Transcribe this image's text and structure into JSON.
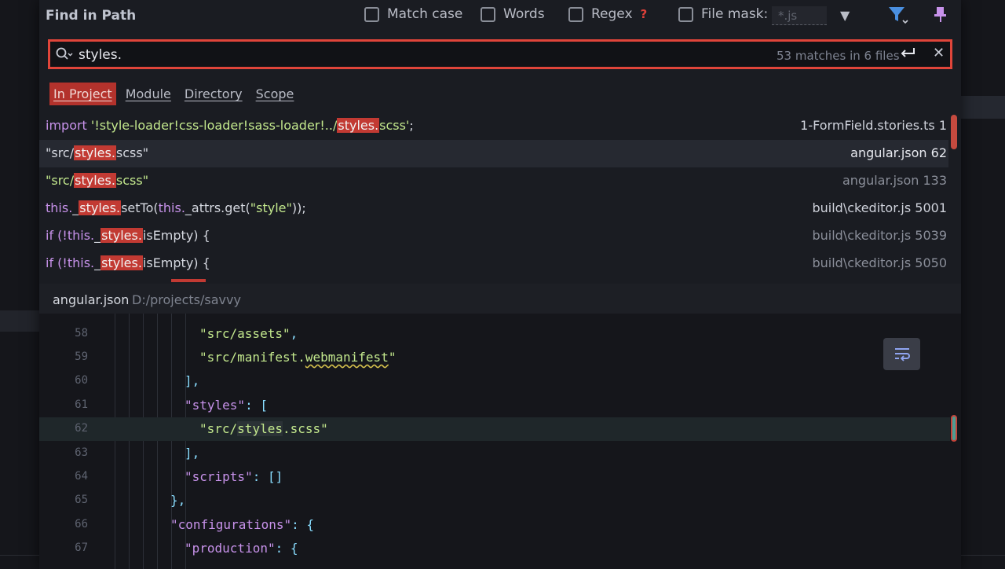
{
  "header": {
    "title": "Find in Path",
    "options": {
      "match_case": "Match case",
      "words": "Words",
      "regex": "Regex",
      "regex_help": "?",
      "file_mask": "File mask:"
    },
    "file_mask_value": "*.js"
  },
  "search": {
    "query": "styles.",
    "match_summary": "53 matches in 6 files"
  },
  "scopes": [
    "In Project",
    "Module",
    "Directory",
    "Scope"
  ],
  "results": [
    {
      "file": "1-FormField.stories.ts 1"
    },
    {
      "file": "angular.json 62"
    },
    {
      "file": "angular.json 133"
    },
    {
      "file": "build\\ckeditor.js 5001"
    },
    {
      "file": "build\\ckeditor.js 5039"
    },
    {
      "file": "build\\ckeditor.js 5050"
    }
  ],
  "result_code": {
    "r0": {
      "a": "import ",
      "b": "'!style-loader!css-loader!sass-loader!../",
      "hl": "styles.",
      "c": "scss'",
      "d": ";"
    },
    "r1": {
      "a": "\"src/",
      "hl": "styles.",
      "b": "scss\""
    },
    "r2": {
      "a": "\"src/",
      "hl": "styles.",
      "b": "scss\""
    },
    "r3": {
      "a": "this.",
      "b": "_",
      "hl": "styles.",
      "c": "setTo(",
      "d": "this.",
      "e": "_attrs.get(",
      "f": "\"style\"",
      "g": "));"
    },
    "r4": {
      "a": "if (!",
      "b": "this.",
      "c": "_",
      "hl": "styles.",
      "d": "isEmpty) {"
    },
    "r5": {
      "a": "if (!",
      "b": "this.",
      "c": "_",
      "hl": "styles.",
      "d": "isEmpty) {"
    }
  },
  "preview": {
    "file": "angular.json",
    "path": "D:/projects/savvy",
    "lines": [
      {
        "n": "58",
        "text": "\"src/assets\"",
        "tail": ","
      },
      {
        "n": "59",
        "text1": "\"src/manifest.",
        "sq": "webmanifest",
        "text2": "\""
      },
      {
        "n": "60",
        "text": "],"
      },
      {
        "n": "61",
        "key": "\"styles\"",
        "rest": ": ["
      },
      {
        "n": "62",
        "t1": "\"src/",
        "w": "styles",
        "t2": ".scss\""
      },
      {
        "n": "63",
        "text": "],"
      },
      {
        "n": "64",
        "key": "\"scripts\"",
        "rest": ": []"
      },
      {
        "n": "65",
        "text": "},"
      },
      {
        "n": "66",
        "key": "\"configurations\"",
        "rest": ": {"
      },
      {
        "n": "67",
        "key": "\"production\"",
        "rest": ": {"
      }
    ]
  },
  "colors": {
    "accent": "#e0453a",
    "highlight": "#c23a33",
    "keyword": "#c792ea",
    "string": "#c3e88d"
  }
}
